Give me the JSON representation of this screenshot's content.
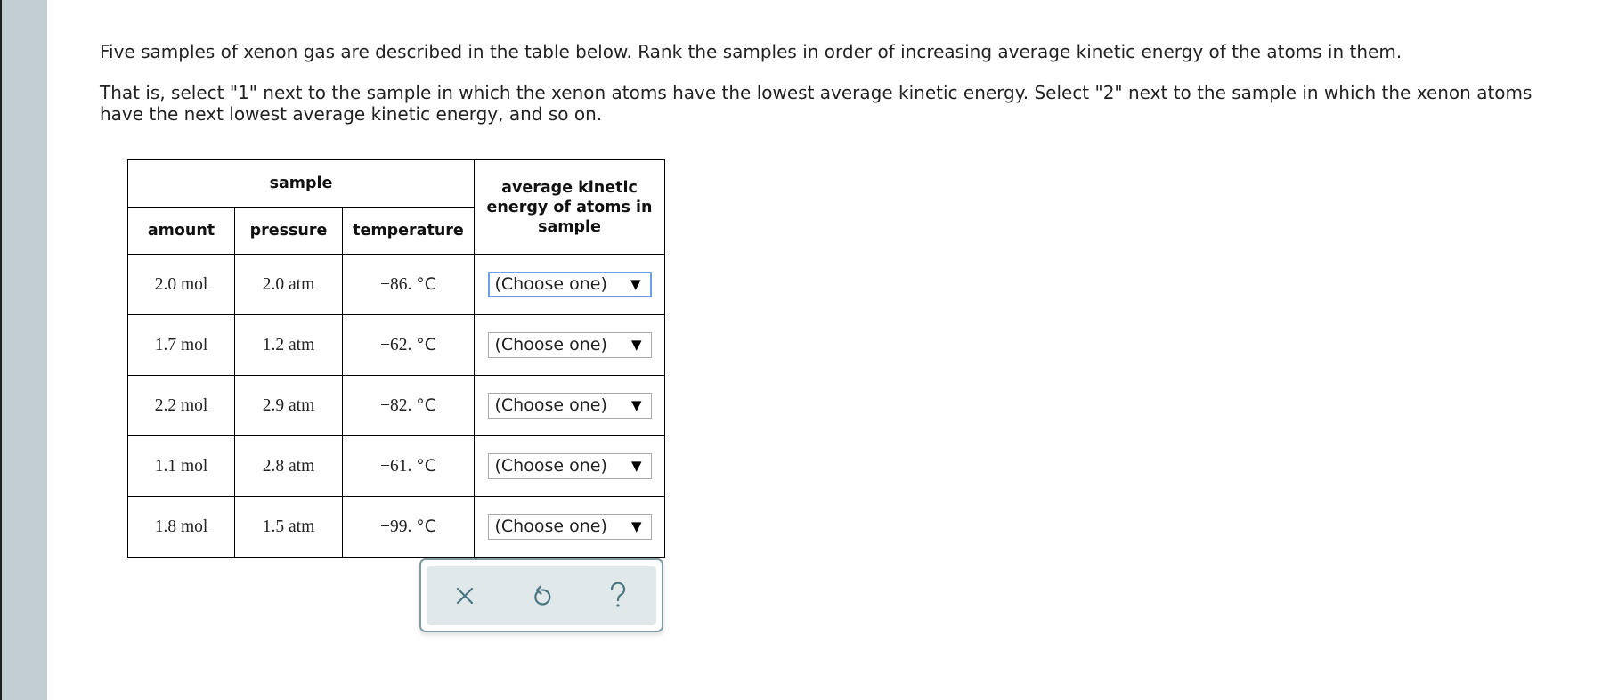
{
  "prompt": {
    "paragraph1": "Five samples of xenon gas are described in the table below. Rank the samples in order of increasing average kinetic energy of the atoms in them.",
    "paragraph2_line1": "That is, select \"1\" next to the sample in which the xenon atoms have the lowest average kinetic energy. Select \"2\" next to the sample in which the xenon atoms",
    "paragraph2_line2": "have the next lowest average kinetic energy, and so on."
  },
  "table": {
    "group_header": "sample",
    "columns": [
      "amount",
      "pressure",
      "temperature"
    ],
    "rank_header": "average kinetic energy of atoms in sample",
    "rows": [
      {
        "amount": "2.0 mol",
        "pressure": "2.0 atm",
        "temperature": "−86.",
        "temp_unit": "°C",
        "rank": "(Choose one)"
      },
      {
        "amount": "1.7 mol",
        "pressure": "1.2 atm",
        "temperature": "−62.",
        "temp_unit": "°C",
        "rank": "(Choose one)"
      },
      {
        "amount": "2.2 mol",
        "pressure": "2.9 atm",
        "temperature": "−82.",
        "temp_unit": "°C",
        "rank": "(Choose one)"
      },
      {
        "amount": "1.1 mol",
        "pressure": "2.8 atm",
        "temperature": "−61.",
        "temp_unit": "°C",
        "rank": "(Choose one)"
      },
      {
        "amount": "1.8 mol",
        "pressure": "1.5 atm",
        "temperature": "−99.",
        "temp_unit": "°C",
        "rank": "(Choose one)"
      }
    ],
    "dropdown_arrow": "▼"
  },
  "toolbar": {
    "buttons": [
      {
        "name": "clear",
        "icon": "close-icon"
      },
      {
        "name": "undo",
        "icon": "undo-icon"
      },
      {
        "name": "help",
        "icon": "help-icon"
      }
    ]
  },
  "colors": {
    "side_panel": "#c3ced4",
    "toolbar_border": "#7f9aa4",
    "toolbar_bg": "#e1e8ea",
    "toolbar_icon": "#4a7582",
    "focus_border": "#6d9eea"
  }
}
